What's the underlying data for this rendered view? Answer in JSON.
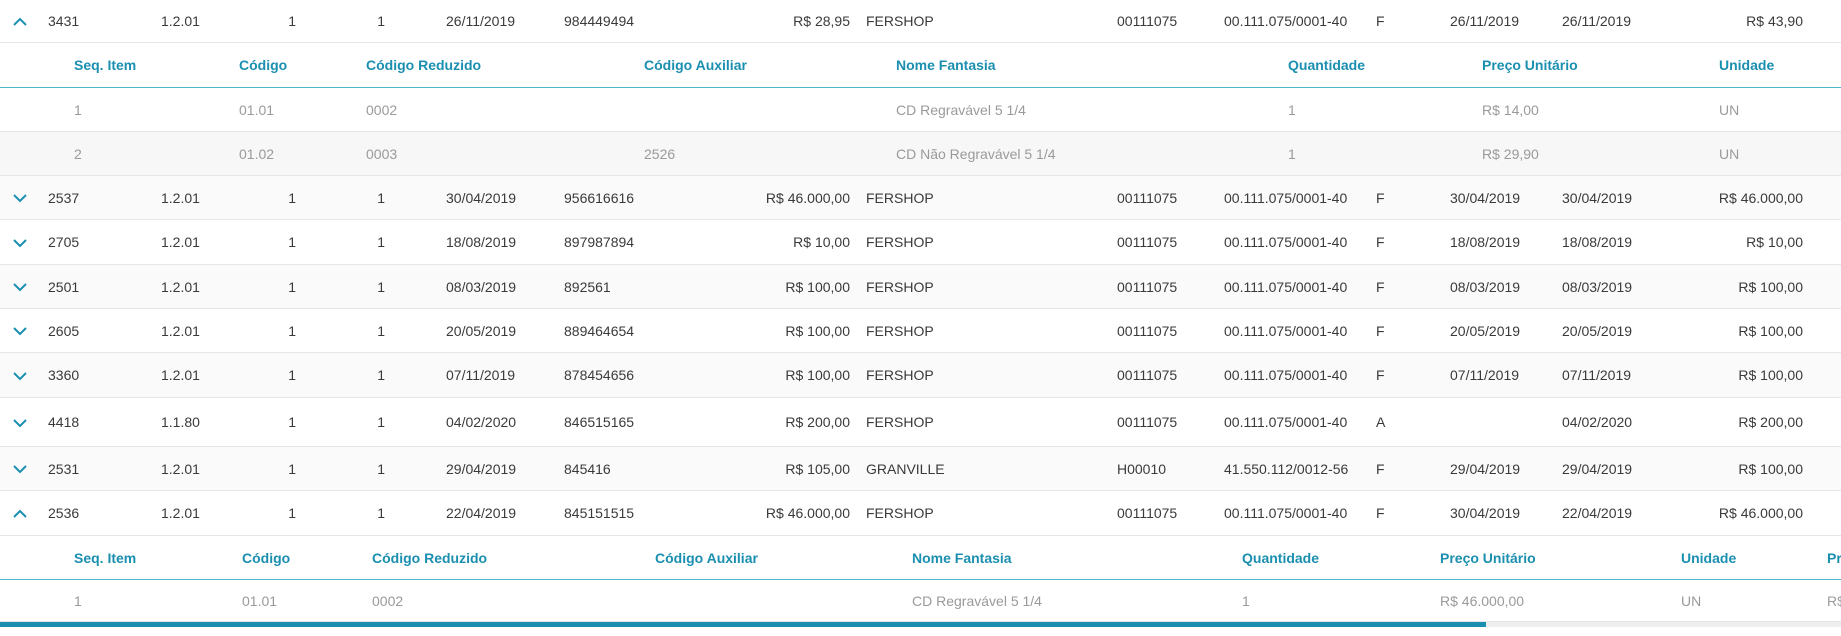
{
  "icons": {
    "expanded": "chevron-up-icon",
    "collapsed": "chevron-down-icon"
  },
  "colors": {
    "accent": "#1b8fb0",
    "sub_text": "#9a9a9a",
    "divider": "#4fb6c9"
  },
  "rows": [
    {
      "expanded": true,
      "seq": "3431",
      "conta": "1.2.01",
      "a": "1",
      "b": "1",
      "emissao": "26/11/2019",
      "nota": "984449494",
      "valor": "R$ 28,95",
      "fantasia": "FERSHOP",
      "codigo": "00111075",
      "cnpj": "00.111.075/0001-40",
      "status": "F",
      "data1": "26/11/2019",
      "data2": "26/11/2019",
      "total": "R$ 43,90"
    },
    {
      "expanded": false,
      "seq": "2537",
      "conta": "1.2.01",
      "a": "1",
      "b": "1",
      "emissao": "30/04/2019",
      "nota": "956616616",
      "valor": "R$ 46.000,00",
      "fantasia": "FERSHOP",
      "codigo": "00111075",
      "cnpj": "00.111.075/0001-40",
      "status": "F",
      "data1": "30/04/2019",
      "data2": "30/04/2019",
      "total": "R$ 46.000,00"
    },
    {
      "expanded": false,
      "seq": "2705",
      "conta": "1.2.01",
      "a": "1",
      "b": "1",
      "emissao": "18/08/2019",
      "nota": "897987894",
      "valor": "R$ 10,00",
      "fantasia": "FERSHOP",
      "codigo": "00111075",
      "cnpj": "00.111.075/0001-40",
      "status": "F",
      "data1": "18/08/2019",
      "data2": "18/08/2019",
      "total": "R$ 10,00"
    },
    {
      "expanded": false,
      "seq": "2501",
      "conta": "1.2.01",
      "a": "1",
      "b": "1",
      "emissao": "08/03/2019",
      "nota": "892561",
      "valor": "R$ 100,00",
      "fantasia": "FERSHOP",
      "codigo": "00111075",
      "cnpj": "00.111.075/0001-40",
      "status": "F",
      "data1": "08/03/2019",
      "data2": "08/03/2019",
      "total": "R$ 100,00"
    },
    {
      "expanded": false,
      "seq": "2605",
      "conta": "1.2.01",
      "a": "1",
      "b": "1",
      "emissao": "20/05/2019",
      "nota": "889464654",
      "valor": "R$ 100,00",
      "fantasia": "FERSHOP",
      "codigo": "00111075",
      "cnpj": "00.111.075/0001-40",
      "status": "F",
      "data1": "20/05/2019",
      "data2": "20/05/2019",
      "total": "R$ 100,00"
    },
    {
      "expanded": false,
      "seq": "3360",
      "conta": "1.2.01",
      "a": "1",
      "b": "1",
      "emissao": "07/11/2019",
      "nota": "878454656",
      "valor": "R$ 100,00",
      "fantasia": "FERSHOP",
      "codigo": "00111075",
      "cnpj": "00.111.075/0001-40",
      "status": "F",
      "data1": "07/11/2019",
      "data2": "07/11/2019",
      "total": "R$ 100,00"
    },
    {
      "expanded": false,
      "seq": "4418",
      "conta": "1.1.80",
      "a": "1",
      "b": "1",
      "emissao": "04/02/2020",
      "nota": "846515165",
      "valor": "R$ 200,00",
      "fantasia": "FERSHOP",
      "codigo": "00111075",
      "cnpj": "00.111.075/0001-40",
      "status": "A",
      "data1": "",
      "data2": "04/02/2020",
      "total": "R$ 200,00"
    },
    {
      "expanded": false,
      "seq": "2531",
      "conta": "1.2.01",
      "a": "1",
      "b": "1",
      "emissao": "29/04/2019",
      "nota": "845416",
      "valor": "R$ 105,00",
      "fantasia": "GRANVILLE",
      "codigo": "H00010",
      "cnpj": "41.550.112/0012-56",
      "status": "F",
      "data1": "29/04/2019",
      "data2": "29/04/2019",
      "total": "R$ 100,00"
    },
    {
      "expanded": true,
      "seq": "2536",
      "conta": "1.2.01",
      "a": "1",
      "b": "1",
      "emissao": "22/04/2019",
      "nota": "845151515",
      "valor": "R$ 46.000,00",
      "fantasia": "FERSHOP",
      "codigo": "00111075",
      "cnpj": "00.111.075/0001-40",
      "status": "F",
      "data1": "30/04/2019",
      "data2": "22/04/2019",
      "total": "R$ 46.000,00"
    }
  ],
  "subtables": [
    {
      "headers": [
        "Seq. Item",
        "Código",
        "Código Reduzido",
        "Código Auxiliar",
        "Nome Fantasia",
        "Quantidade",
        "Preço Unitário",
        "Unidade"
      ],
      "items": [
        [
          "1",
          "01.01",
          "0002",
          "",
          "CD Regravável 5 1/4",
          "1",
          "R$ 14,00",
          "UN"
        ],
        [
          "2",
          "01.02",
          "0003",
          "2526",
          "CD Não Regravável 5 1/4",
          "1",
          "R$ 29,90",
          "UN"
        ]
      ]
    },
    {
      "headers": [
        "Seq. Item",
        "Código",
        "Código Reduzido",
        "Código Auxiliar",
        "Nome Fantasia",
        "Quantidade",
        "Preço Unitário",
        "Unidade",
        "Pr"
      ],
      "items": [
        [
          "1",
          "01.01",
          "0002",
          "",
          "CD Regravável 5 1/4",
          "1",
          "R$ 46.000,00",
          "UN",
          "R$"
        ]
      ]
    }
  ]
}
